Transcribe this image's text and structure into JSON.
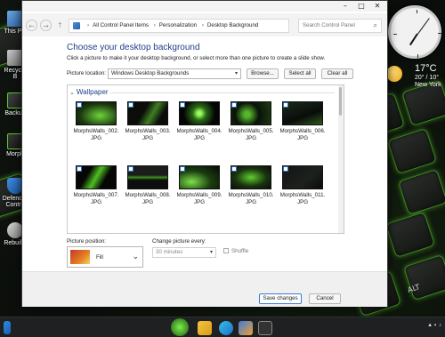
{
  "desktop": {
    "icons": [
      {
        "label": "This PC"
      },
      {
        "label": "Recycle B"
      },
      {
        "label": "Backup"
      },
      {
        "label": "Morph"
      },
      {
        "label": "Defender Contro"
      },
      {
        "label": "Rebuildi"
      }
    ],
    "key_label": "ALT",
    "accent_color": "#5ac828"
  },
  "clock": {
    "hour": 7,
    "minute": 6
  },
  "weather": {
    "temperature": "17°C",
    "range": "20° / 10°",
    "city": "New York",
    "icon": "sun-icon"
  },
  "window": {
    "controls": {
      "minimize": "–",
      "maximize": "□",
      "close": "✕"
    },
    "breadcrumbs": [
      "All Control Panel Items",
      "Personalization",
      "Desktop Background"
    ],
    "search_placeholder": "Search Control Panel",
    "heading": "Choose your desktop background",
    "subtext": "Click a picture to make it your desktop background, or select more than one picture to create a slide show.",
    "picture_location_label": "Picture location:",
    "picture_location_value": "Windows Desktop Backgrounds",
    "buttons": {
      "browse": "Browse...",
      "select_all": "Select all",
      "clear_all": "Clear all"
    },
    "group_name": "Wallpaper",
    "thumbnails": [
      {
        "name": "MorphsWalls_002.",
        "ext": "JPG",
        "style": "a"
      },
      {
        "name": "MorphsWalls_003.",
        "ext": "JPG",
        "style": "b"
      },
      {
        "name": "MorphsWalls_004.",
        "ext": "JPG",
        "style": "c"
      },
      {
        "name": "MorphsWalls_005.",
        "ext": "JPG",
        "style": "d"
      },
      {
        "name": "MorphsWalls_006.",
        "ext": "JPG",
        "style": "e"
      },
      {
        "name": "MorphsWalls_007.",
        "ext": "JPG",
        "style": "f"
      },
      {
        "name": "MorphsWalls_008.",
        "ext": "JPG",
        "style": "g"
      },
      {
        "name": "MorphsWalls_009.",
        "ext": "JPG",
        "style": "h"
      },
      {
        "name": "MorphsWalls_010.",
        "ext": "JPG",
        "style": "i"
      },
      {
        "name": "MorphsWalls_011.",
        "ext": "JPG",
        "style": "j"
      }
    ],
    "picture_position_label": "Picture position:",
    "picture_position_value": "Fill",
    "change_every_label": "Change picture every:",
    "change_every_value": "30 minutes",
    "shuffle_label": "Shuffle",
    "save_button": "Save changes",
    "cancel_button": "Cancel"
  },
  "taskbar": {
    "items": [
      "start-icon",
      "razer-icon",
      "file-explorer-icon",
      "edge-icon",
      "store-icon",
      "settings-icon",
      "control-panel-icon"
    ]
  }
}
